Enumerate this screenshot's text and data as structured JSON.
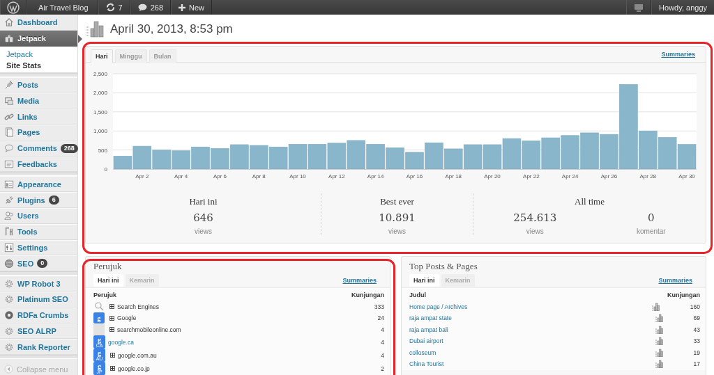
{
  "admin_bar": {
    "site": "Air Travel Blog",
    "updates": "7",
    "comments": "268",
    "new": "New",
    "greeting": "Howdy, anggy"
  },
  "sidebar": {
    "groups": [
      {
        "items": [
          {
            "label": "Dashboard",
            "selected": false
          },
          {
            "label": "Jetpack",
            "selected": true,
            "children": [
              {
                "label": "Jetpack",
                "selected": false
              },
              {
                "label": "Site Stats",
                "selected": true
              }
            ]
          }
        ]
      },
      {
        "items": [
          {
            "label": "Posts",
            "selected": false
          },
          {
            "label": "Media",
            "selected": false
          },
          {
            "label": "Links",
            "selected": false
          },
          {
            "label": "Pages",
            "selected": false
          },
          {
            "label": "Comments",
            "selected": false,
            "badge": "268"
          },
          {
            "label": "Feedbacks",
            "selected": false
          }
        ]
      },
      {
        "items": [
          {
            "label": "Appearance",
            "selected": false
          },
          {
            "label": "Plugins",
            "selected": false,
            "badge": "6"
          },
          {
            "label": "Users",
            "selected": false
          },
          {
            "label": "Tools",
            "selected": false
          },
          {
            "label": "Settings",
            "selected": false
          },
          {
            "label": "SEO",
            "selected": false,
            "badge": "0"
          }
        ]
      },
      {
        "items": [
          {
            "label": "WP Robot 3",
            "selected": false
          },
          {
            "label": "Platinum SEO",
            "selected": false
          },
          {
            "label": "RDFa Crumbs",
            "selected": false
          },
          {
            "label": "SEO ALRP",
            "selected": false
          },
          {
            "label": "Rank Reporter",
            "selected": false
          }
        ]
      }
    ],
    "collapse": "Collapse menu"
  },
  "page_title": "April 30, 2013, 8:53 pm",
  "stats": {
    "tabs": [
      {
        "label": "Hari",
        "selected": true
      },
      {
        "label": "Minggu",
        "selected": false
      },
      {
        "label": "Bulan",
        "selected": false
      }
    ],
    "summaries": "Summaries",
    "chart_data": {
      "type": "bar",
      "categories": [
        null,
        "Apr 2",
        null,
        "Apr 4",
        null,
        "Apr 6",
        null,
        "Apr 8",
        null,
        "Apr 10",
        null,
        "Apr 12",
        null,
        "Apr 14",
        null,
        "Apr 16",
        null,
        "Apr 18",
        null,
        "Apr 20",
        null,
        "Apr 22",
        null,
        "Apr 24",
        null,
        "Apr 26",
        null,
        "Apr 28",
        null,
        "Apr 30"
      ],
      "grid": true,
      "values": [
        340,
        600,
        500,
        480,
        580,
        540,
        640,
        620,
        580,
        650,
        650,
        680,
        750,
        650,
        560,
        440,
        690,
        530,
        640,
        640,
        800,
        740,
        820,
        880,
        950,
        910,
        2220,
        1000,
        830,
        646
      ],
      "ylim": [
        0,
        2500
      ],
      "yticks": [
        {
          "value": 0,
          "label": "0"
        },
        {
          "value": 500,
          "label": "500"
        },
        {
          "value": 1000,
          "label": "1,000"
        },
        {
          "value": 1500,
          "label": "1,500"
        },
        {
          "value": 2000,
          "label": "2,000"
        },
        {
          "value": 2500,
          "label": "2,500"
        }
      ]
    },
    "summary": [
      {
        "title": "Hari ini",
        "figures": [
          {
            "value": "646",
            "unit": "views"
          }
        ]
      },
      {
        "title": "Best ever",
        "figures": [
          {
            "value": "10.891",
            "unit": "views"
          }
        ]
      },
      {
        "title": "All time",
        "figures": [
          {
            "value": "254.613",
            "unit": "views"
          },
          {
            "value": "0",
            "unit": "komentar"
          }
        ]
      }
    ]
  },
  "modules": [
    {
      "title": "Perujuk",
      "tabs": [
        {
          "label": "Hari ini",
          "selected": true
        },
        {
          "label": "Kemarin",
          "selected": false
        }
      ],
      "summaries": "Summaries",
      "columns": [
        "Perujuk",
        "Kunjungan"
      ],
      "rows": [
        {
          "kind": "search",
          "expandable": true,
          "link": false,
          "name": "Search Engines",
          "count": "333"
        },
        {
          "kind": "google",
          "icon_text": "g",
          "expandable": true,
          "link": false,
          "name": "Google",
          "count": "24"
        },
        {
          "kind": "blank",
          "expandable": true,
          "link": false,
          "name": "searchmobileonline.com",
          "count": "4"
        },
        {
          "kind": "google",
          "icon_text": "g",
          "country": "CA",
          "expandable": false,
          "link": true,
          "name": "google.ca",
          "count": "4"
        },
        {
          "kind": "google",
          "icon_text": "g",
          "country": "AU",
          "expandable": true,
          "link": false,
          "name": "google.com.au",
          "count": "4"
        },
        {
          "kind": "google",
          "icon_text": "g",
          "country": "JP",
          "expandable": true,
          "link": false,
          "name": "google.co.jp",
          "count": "2"
        }
      ]
    },
    {
      "title": "Top Posts & Pages",
      "tabs": [
        {
          "label": "Hari ini",
          "selected": true
        },
        {
          "label": "Kemarin",
          "selected": false
        }
      ],
      "summaries": "Summaries",
      "columns": [
        "Judul",
        "Kunjungan"
      ],
      "rows": [
        {
          "kind": "post",
          "link": true,
          "name": "Home page / Archives",
          "count": "160"
        },
        {
          "kind": "post",
          "link": true,
          "name": "raja ampat state",
          "count": "69"
        },
        {
          "kind": "post",
          "link": true,
          "name": "raja ampat bali",
          "count": "43"
        },
        {
          "kind": "post",
          "link": true,
          "name": "Dubai airport",
          "count": "33"
        },
        {
          "kind": "post",
          "link": true,
          "name": "colloseum",
          "count": "19"
        },
        {
          "kind": "post",
          "link": true,
          "name": "China Tourist",
          "count": "17"
        }
      ]
    }
  ]
}
